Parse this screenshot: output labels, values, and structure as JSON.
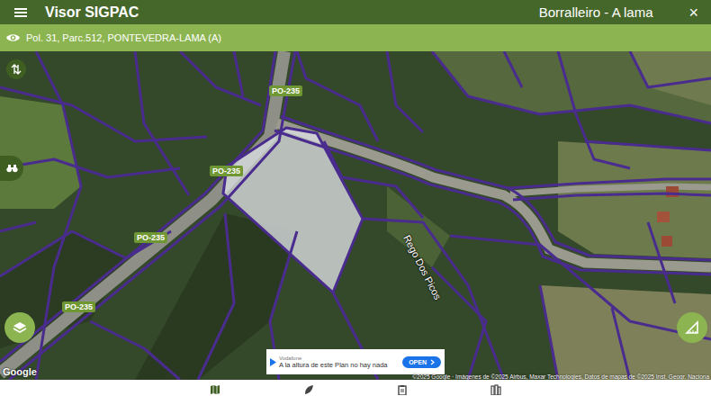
{
  "app_bar": {
    "title": "Visor SIGPAC",
    "place": "Borralleiro - A lama",
    "close": "×"
  },
  "parcel_bar": {
    "text": "Pol. 31, Parc.512, PONTEVEDRA-LAMA (A)"
  },
  "map": {
    "road_labels": [
      {
        "text": "PO-235"
      },
      {
        "text": "PO-235"
      },
      {
        "text": "PO-235"
      },
      {
        "text": "PO-235"
      }
    ],
    "stream_label": "Rego Dos Picos",
    "selected_parcel": true,
    "logo": "Google",
    "attribution": "©2025 Google · Imágenes de ©2025 Airbus, Maxar Technologies, Datos de mapas de ©2025 Inst. Geogr. Naciona"
  },
  "ad": {
    "sponsor": "Vodafone",
    "text": "A la altura de este Plan no hay nada",
    "button": "OPEN"
  },
  "bottom_nav": [
    {
      "selected": true
    },
    {
      "selected": false
    },
    {
      "selected": false
    },
    {
      "selected": false
    }
  ]
}
